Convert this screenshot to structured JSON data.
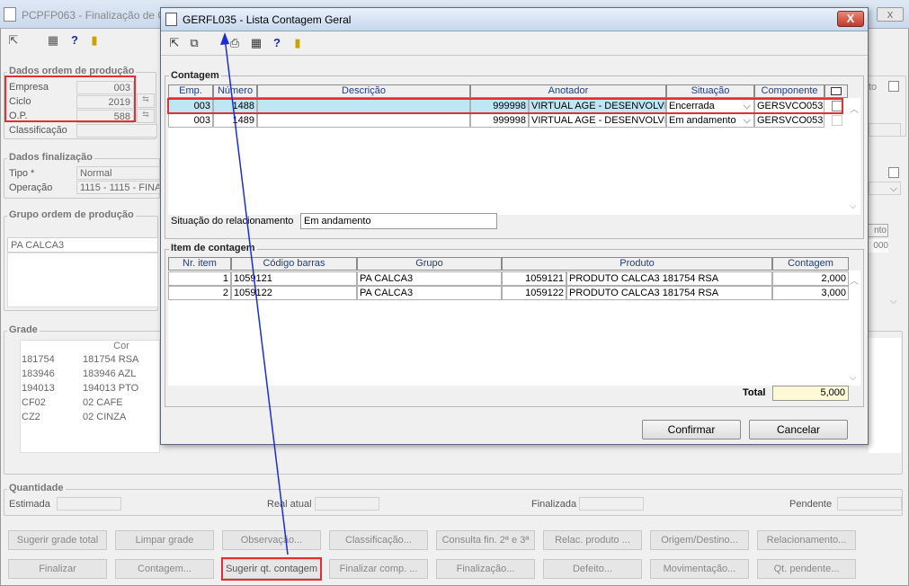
{
  "bg": {
    "title": "PCPFP063 - Finalização de Or",
    "close_icon": "x",
    "ordem": {
      "section": "Dados ordem de produção",
      "empresa_label": "Empresa",
      "empresa_value": "003",
      "ciclo_label": "Ciclo",
      "ciclo_value": "2019",
      "op_label": "O.P.",
      "op_value": "588",
      "classificacao_label": "Classificação"
    },
    "finalizacao": {
      "section": "Dados finalização",
      "tipo_label": "Tipo *",
      "tipo_value": "Normal",
      "operacao_label": "Operação",
      "operacao_value": "1115 - 1115 - FINA"
    },
    "grupo": {
      "section": "Grupo ordem de produção",
      "value": "PA CALCA3",
      "right_header": "nto",
      "right_value": "000"
    },
    "grade": {
      "section": "Grade",
      "col_cor": "Cor",
      "rows": [
        [
          "181754",
          "181754 RSA"
        ],
        [
          "183946",
          "183946 AZL"
        ],
        [
          "194013",
          "194013 PTO"
        ],
        [
          "CF02",
          "02 CAFE"
        ],
        [
          "CZ2",
          "02 CINZA"
        ]
      ]
    },
    "quantidade": {
      "section": "Quantidade",
      "estimada": "Estimada",
      "real_atual": "Real atual",
      "finalizada": "Finalizada",
      "pendente": "Pendente"
    },
    "right_edge_text": "to",
    "buttons_row1": [
      "Sugerir grade total",
      "Limpar grade",
      "Observação...",
      "Classificação...",
      "Consulta fin. 2ª e 3ª",
      "Relac. produto ...",
      "Origem/Destino...",
      "Relacionamento..."
    ],
    "buttons_row2": [
      "Finalizar",
      "Contagem...",
      "Sugerir qt. contagem",
      "Finalizar comp. ...",
      "Finalização...",
      "Defeito...",
      "Movimentação...",
      "Qt. pendente..."
    ]
  },
  "dialog": {
    "title": "GERFL035 - Lista Contagem Geral",
    "close_label": "X",
    "toolbar_icons": [
      "exit-icon",
      "copy-icon",
      "print-icon",
      "grid-icon",
      "help-icon",
      "door-icon"
    ],
    "contagem": {
      "section": "Contagem",
      "headers": [
        "Emp.",
        "Número",
        "Descrição",
        "Anotador",
        "Situação",
        "Componente"
      ],
      "rows": [
        {
          "emp": "003",
          "numero": "1488",
          "descricao": "",
          "anot_code": "999998",
          "anot_name": "VIRTUAL AGE - DESENVOLVIM",
          "situacao": "Encerrada",
          "componente": "GERSVCO053"
        },
        {
          "emp": "003",
          "numero": "1489",
          "descricao": "",
          "anot_code": "999998",
          "anot_name": "VIRTUAL AGE - DESENVOLVIM",
          "situacao": "Em andamento",
          "componente": "GERSVCO053"
        }
      ],
      "situacao_rel_label": "Situação do relacionamento",
      "situacao_rel_value": "Em andamento"
    },
    "item": {
      "section": "Item de contagem",
      "headers": [
        "Nr. item",
        "Código barras",
        "Grupo",
        "Produto",
        "Contagem"
      ],
      "rows": [
        {
          "nr": "1",
          "codigo": "1059121",
          "grupo": "PA CALCA3",
          "prod_code": "1059121",
          "prod_name": "PRODUTO CALCA3 181754 RSA",
          "contagem": "2,000"
        },
        {
          "nr": "2",
          "codigo": "1059122",
          "grupo": "PA CALCA3",
          "prod_code": "1059122",
          "prod_name": "PRODUTO CALCA3 181754 RSA",
          "contagem": "3,000"
        }
      ],
      "total_label": "Total",
      "total_value": "5,000"
    },
    "confirm_label": "Confirmar",
    "cancel_label": "Cancelar"
  }
}
